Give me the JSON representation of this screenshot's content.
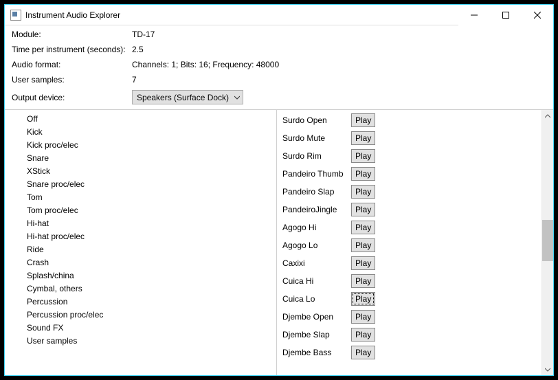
{
  "window": {
    "title": "Instrument Audio Explorer"
  },
  "info": {
    "module": {
      "label": "Module:",
      "value": "TD-17"
    },
    "time_per_instrument": {
      "label": "Time per instrument (seconds):",
      "value": "2.5"
    },
    "audio_format": {
      "label": "Audio format:",
      "value": "Channels: 1; Bits: 16; Frequency: 48000"
    },
    "user_samples": {
      "label": "User samples:",
      "value": "7"
    },
    "output_device": {
      "label": "Output device:",
      "selected": "Speakers (Surface Dock)"
    }
  },
  "categories": [
    "Off",
    "Kick",
    "Kick proc/elec",
    "Snare",
    "XStick",
    "Snare proc/elec",
    "Tom",
    "Tom proc/elec",
    "Hi-hat",
    "Hi-hat proc/elec",
    "Ride",
    "Crash",
    "Splash/china",
    "Cymbal, others",
    "Percussion",
    "Percussion proc/elec",
    "Sound FX",
    "User samples"
  ],
  "play_label": "Play",
  "instruments": [
    {
      "name": "Surdo Open",
      "focused": false
    },
    {
      "name": "Surdo Mute",
      "focused": false
    },
    {
      "name": "Surdo Rim",
      "focused": false
    },
    {
      "name": "Pandeiro Thumb",
      "focused": false
    },
    {
      "name": "Pandeiro Slap",
      "focused": false
    },
    {
      "name": "PandeiroJingle",
      "focused": false
    },
    {
      "name": "Agogo Hi",
      "focused": false
    },
    {
      "name": "Agogo Lo",
      "focused": false
    },
    {
      "name": "Caxixi",
      "focused": false
    },
    {
      "name": "Cuica Hi",
      "focused": false
    },
    {
      "name": "Cuica Lo",
      "focused": true
    },
    {
      "name": "Djembe Open",
      "focused": false
    },
    {
      "name": "Djembe Slap",
      "focused": false
    },
    {
      "name": "Djembe Bass",
      "focused": false
    }
  ]
}
